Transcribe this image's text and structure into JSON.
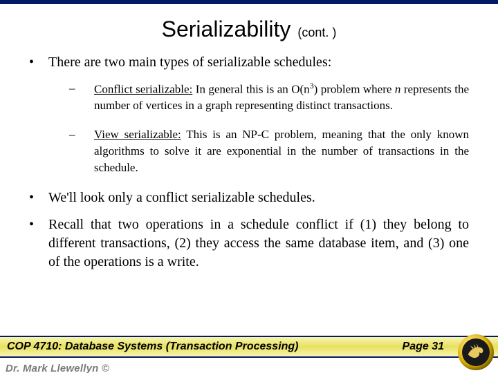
{
  "title": {
    "main": "Serializability",
    "sub": "(cont. )"
  },
  "bullets": {
    "b1": "There are two main types of serializable schedules:",
    "s1_lead": "Conflict serializable:",
    "s1_rest_a": "  In general this is an O(n",
    "s1_sup": "3",
    "s1_rest_b": ") problem where ",
    "s1_n": "n",
    "s1_rest_c": " represents the number of vertices in a graph representing distinct transactions.",
    "s2_lead": "View serializable:",
    "s2_rest": "  This is an NP-C problem, meaning that the only known algorithms to solve it are exponential in the number of transactions in the schedule.",
    "b2": "We'll look only a conflict serializable schedules.",
    "b3": "Recall that two operations in a schedule conflict if (1) they belong to different transactions, (2) they access the same database item, and (3) one of the operations is a write."
  },
  "footer": {
    "course": "COP 4710: Database Systems  (Transaction Processing)",
    "page": "Page 31",
    "author": "Dr. Mark Llewellyn ©"
  },
  "glyphs": {
    "bullet": "•",
    "dash": "–"
  }
}
